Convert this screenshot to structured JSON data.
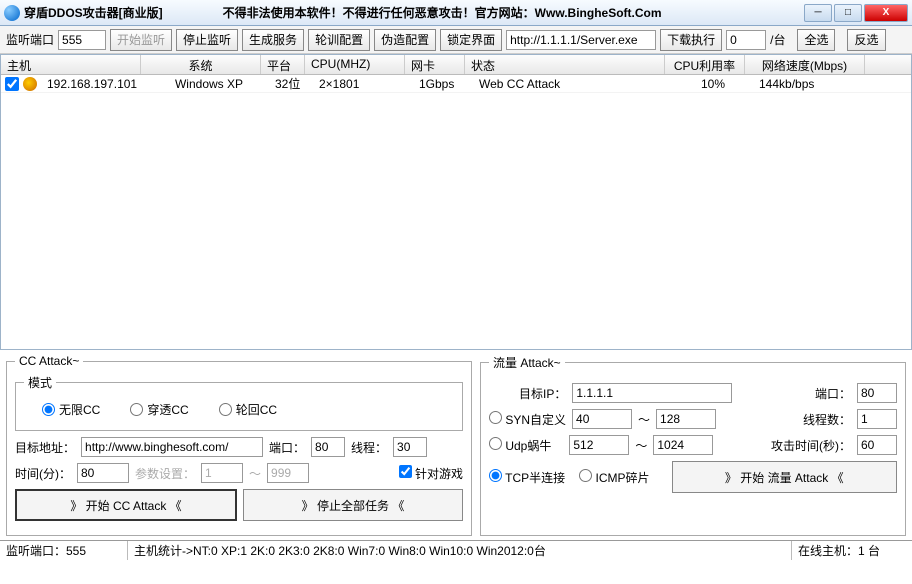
{
  "title": "穿盾DDOS攻击器[商业版]",
  "notice": "不得非法使用本软件！不得进行任何恶意攻击！官方网站：Www.BingheSoft.Com",
  "toolbar": {
    "listen_label": "监听端口",
    "listen_port": "555",
    "start_listen": "开始监听",
    "stop_listen": "停止监听",
    "gen_service": "生成服务",
    "train_cfg": "轮训配置",
    "fake_cfg": "伪造配置",
    "lock_ui": "锁定界面",
    "url": "http://1.1.1.1/Server.exe",
    "download_exec": "下载执行",
    "count": "0",
    "unit": "/台",
    "select_all": "全选",
    "invert": "反选"
  },
  "columns": {
    "host": "主机",
    "sys": "系统",
    "plat": "平台",
    "cpu": "CPU(MHZ)",
    "nic": "网卡",
    "stat": "状态",
    "util": "CPU利用率",
    "speed": "网络速度(Mbps)"
  },
  "row": {
    "host": "192.168.197.101",
    "sys": "Windows XP",
    "plat": "32位",
    "cpu": "2×1801",
    "nic": "1Gbps",
    "stat": "Web CC Attack",
    "util": "10%",
    "speed": "144kb/bps"
  },
  "cc": {
    "legend": "CC Attack~",
    "mode_legend": "模式",
    "mode_unl": "无限CC",
    "mode_pen": "穿透CC",
    "mode_rot": "轮回CC",
    "target_label": "目标地址：",
    "target": "http://www.binghesoft.com/",
    "port_label": "端口：",
    "port": "80",
    "thread_label": "线程：",
    "thread": "30",
    "time_label": "时间(分)：",
    "time": "80",
    "param_label": "参数设置：",
    "p1": "1",
    "tilde": "～",
    "p2": "999",
    "game_label": "针对游戏",
    "start": "》  开始 CC Attack  《",
    "stop": "》   停止全部任务   《"
  },
  "flow": {
    "legend": "流量 Attack~",
    "ip_label": "目标IP：",
    "ip": "1.1.1.1",
    "port_label": "端口：",
    "port": "80",
    "syn_label": "SYN自定义",
    "syn1": "40",
    "tilde": "～",
    "syn2": "128",
    "threads_label": "线程数：",
    "threads": "1",
    "udp_label": "Udp蜗牛",
    "udp1": "512",
    "udp2": "1024",
    "atime_label": "攻击时间(秒)：",
    "atime": "60",
    "tcp_label": "TCP半连接",
    "icmp_label": "ICMP碎片",
    "start": "》   开始 流量 Attack   《"
  },
  "status": {
    "left": "监听端口：555",
    "mid": "主机统计->NT:0 XP:1 2K:0 2K3:0 2K8:0 Win7:0 Win8:0 Win10:0 Win2012:0台",
    "right": "在线主机：1 台"
  }
}
